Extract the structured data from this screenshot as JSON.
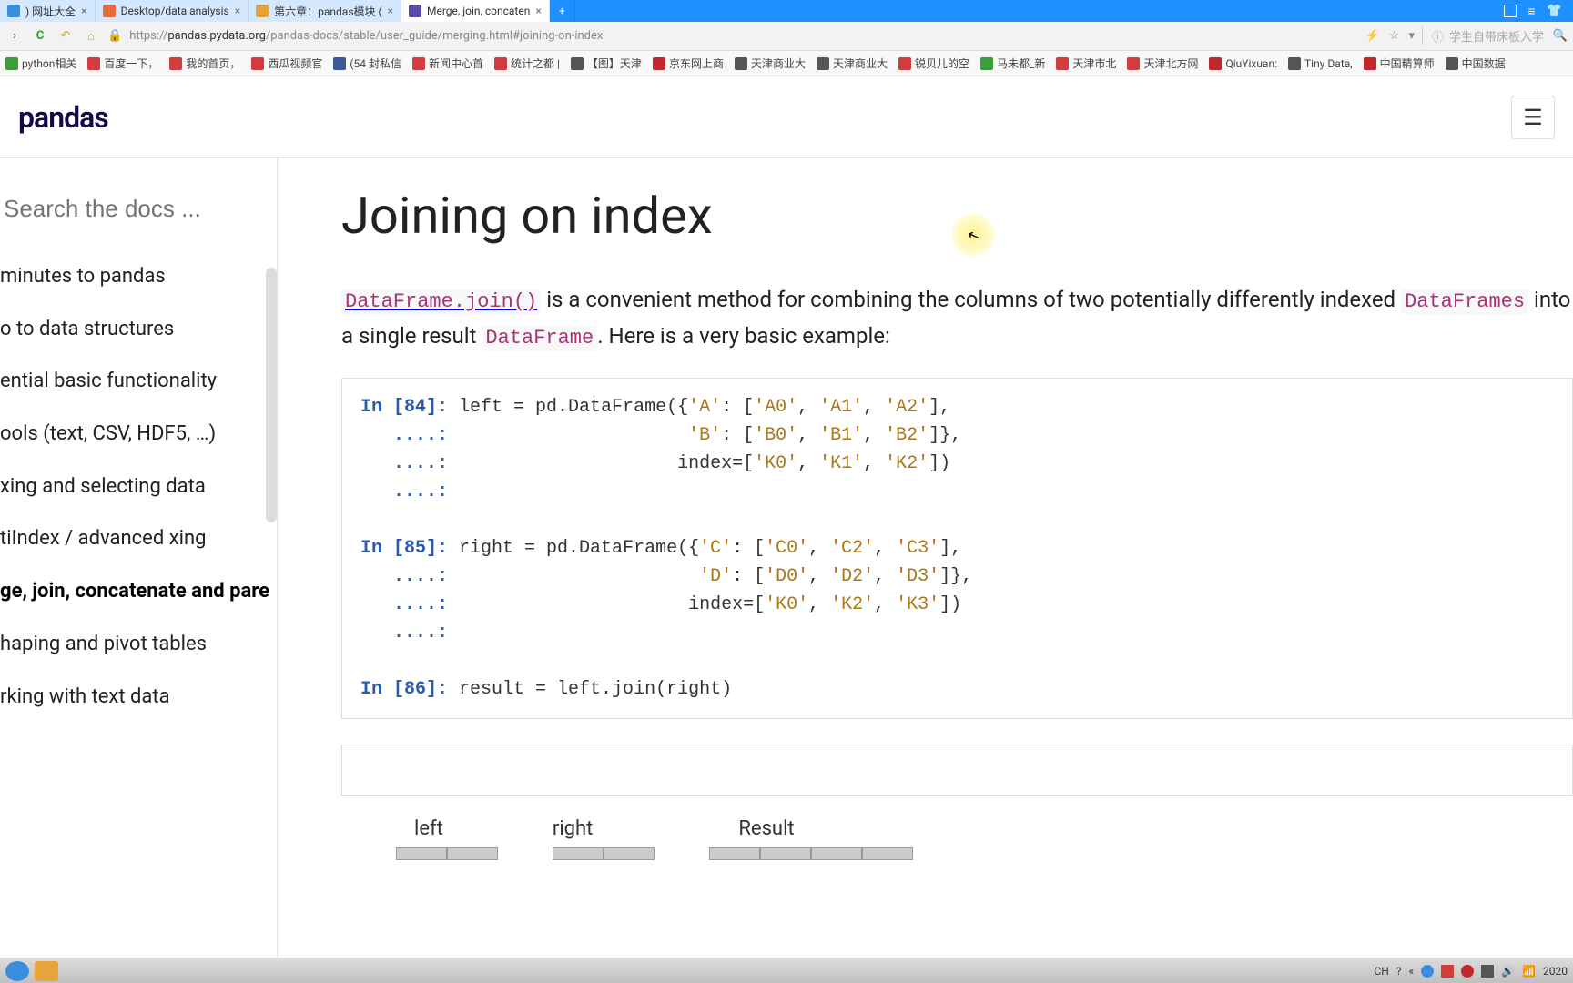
{
  "tabs": [
    {
      "label": ") 网址大全"
    },
    {
      "label": "Desktop/data analysis"
    },
    {
      "label": "第六章：pandas模块 ("
    },
    {
      "label": "Merge, join, concaten"
    }
  ],
  "url": {
    "scheme": "https://",
    "host": "pandas.pydata.org",
    "path": "/pandas-docs/stable/user_guide/merging.html#joining-on-index"
  },
  "browser_search_placeholder": "学生自带床板入学",
  "bookmarks": [
    "python相关",
    "百度一下，",
    "我的首页，",
    "西瓜视频官",
    "(54 封私信",
    "新闻中心首",
    "统计之都 |",
    "【图】天津",
    "京东网上商",
    "天津商业大",
    "天津商业大",
    "锐贝儿的空",
    "马未都_新",
    "天津市北",
    "天津北方网",
    "QiuYixuan:",
    "Tiny Data,",
    "中国精算师",
    "中国数据"
  ],
  "logo": "pandas",
  "search_placeholder": "Search the docs ...",
  "nav": [
    "minutes to pandas",
    "o to data structures",
    "ential basic functionality",
    "ools (text, CSV, HDF5, …)",
    "xing and selecting data",
    "tiIndex / advanced xing",
    "ge, join, concatenate and pare",
    "haping and pivot tables",
    "rking with text data"
  ],
  "nav_active_index": 6,
  "heading": "Joining on index",
  "para": {
    "code1": "DataFrame.join()",
    "t1": " is a convenient method for combining the columns of two potentially differently indexed ",
    "code2": "DataFrames",
    "t2": " into a single result ",
    "code3": "DataFrame",
    "t3": ". Here is a very basic example:"
  },
  "code": {
    "l1a": "In [84]: ",
    "l1b": "left = pd.DataFrame({",
    "l1s1": "'A'",
    "l1c": ": [",
    "l1s2": "'A0'",
    "l1d": ", ",
    "l1s3": "'A1'",
    "l1e": ", ",
    "l1s4": "'A2'",
    "l1f": "],",
    "l2a": "   ....: ",
    "l2sp": "                     ",
    "l2s1": "'B'",
    "l2c": ": [",
    "l2s2": "'B0'",
    "l2d": ", ",
    "l2s3": "'B1'",
    "l2e": ", ",
    "l2s4": "'B2'",
    "l2f": "]},",
    "l3a": "   ....: ",
    "l3sp": "                    index=[",
    "l3s1": "'K0'",
    "l3d": ", ",
    "l3s2": "'K1'",
    "l3e": ", ",
    "l3s3": "'K2'",
    "l3f": "])",
    "l4a": "   ....: ",
    "l5a": "In [85]: ",
    "l5b": "right = pd.DataFrame({",
    "l5s1": "'C'",
    "l5c": ": [",
    "l5s2": "'C0'",
    "l5d": ", ",
    "l5s3": "'C2'",
    "l5e": ", ",
    "l5s4": "'C3'",
    "l5f": "],",
    "l6a": "   ....: ",
    "l6sp": "                      ",
    "l6s1": "'D'",
    "l6c": ": [",
    "l6s2": "'D0'",
    "l6d": ", ",
    "l6s3": "'D2'",
    "l6e": ", ",
    "l6s4": "'D3'",
    "l6f": "]},",
    "l7a": "   ....: ",
    "l7sp": "                     index=[",
    "l7s1": "'K0'",
    "l7d": ", ",
    "l7s2": "'K2'",
    "l7e": ", ",
    "l7s3": "'K3'",
    "l7f": "])",
    "l8a": "   ....: ",
    "l9a": "In [86]: ",
    "l9b": "result = left.join(right)"
  },
  "table_labels": [
    "left",
    "right",
    "Result"
  ],
  "taskbar": {
    "lang": "CH",
    "clock": "2020"
  }
}
